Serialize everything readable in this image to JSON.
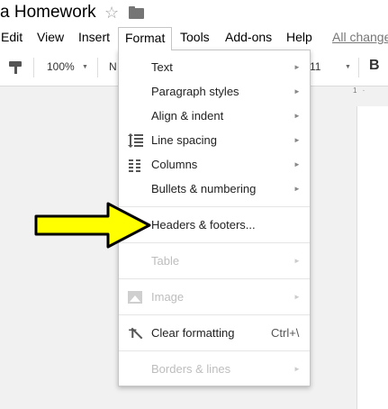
{
  "document": {
    "title": "a Homework",
    "star_icon": "star-icon",
    "folder_icon": "folder-icon"
  },
  "menubar": {
    "items": [
      "Edit",
      "View",
      "Insert",
      "Format",
      "Tools",
      "Add-ons",
      "Help"
    ],
    "active": "Format",
    "changes_link": "All change"
  },
  "toolbar": {
    "paint_format_icon": "paint-format-icon",
    "zoom": "100%",
    "font": "N",
    "font_size": "11",
    "bold": "B"
  },
  "ruler": {
    "text": "1 ·"
  },
  "format_menu": {
    "items": [
      {
        "label": "Text",
        "submenu": true,
        "enabled": true
      },
      {
        "label": "Paragraph styles",
        "submenu": true,
        "enabled": true
      },
      {
        "label": "Align & indent",
        "submenu": true,
        "enabled": true
      },
      {
        "label": "Line spacing",
        "submenu": true,
        "enabled": true,
        "icon": "line-spacing-icon"
      },
      {
        "label": "Columns",
        "submenu": true,
        "enabled": true,
        "icon": "columns-icon"
      },
      {
        "label": "Bullets & numbering",
        "submenu": true,
        "enabled": true
      },
      {
        "label": "Headers & footers...",
        "submenu": false,
        "enabled": true
      },
      {
        "label": "Table",
        "submenu": true,
        "enabled": false
      },
      {
        "label": "Image",
        "submenu": true,
        "enabled": false,
        "icon": "image-icon"
      },
      {
        "label": "Clear formatting",
        "shortcut": "Ctrl+\\",
        "enabled": true,
        "icon": "clear-formatting-icon"
      },
      {
        "label": "Borders & lines",
        "submenu": true,
        "enabled": false
      }
    ],
    "submenu_arrow": "►"
  },
  "annotation": {
    "icon": "yellow-arrow-icon",
    "color": "#ffff00",
    "outline": "#000000"
  }
}
